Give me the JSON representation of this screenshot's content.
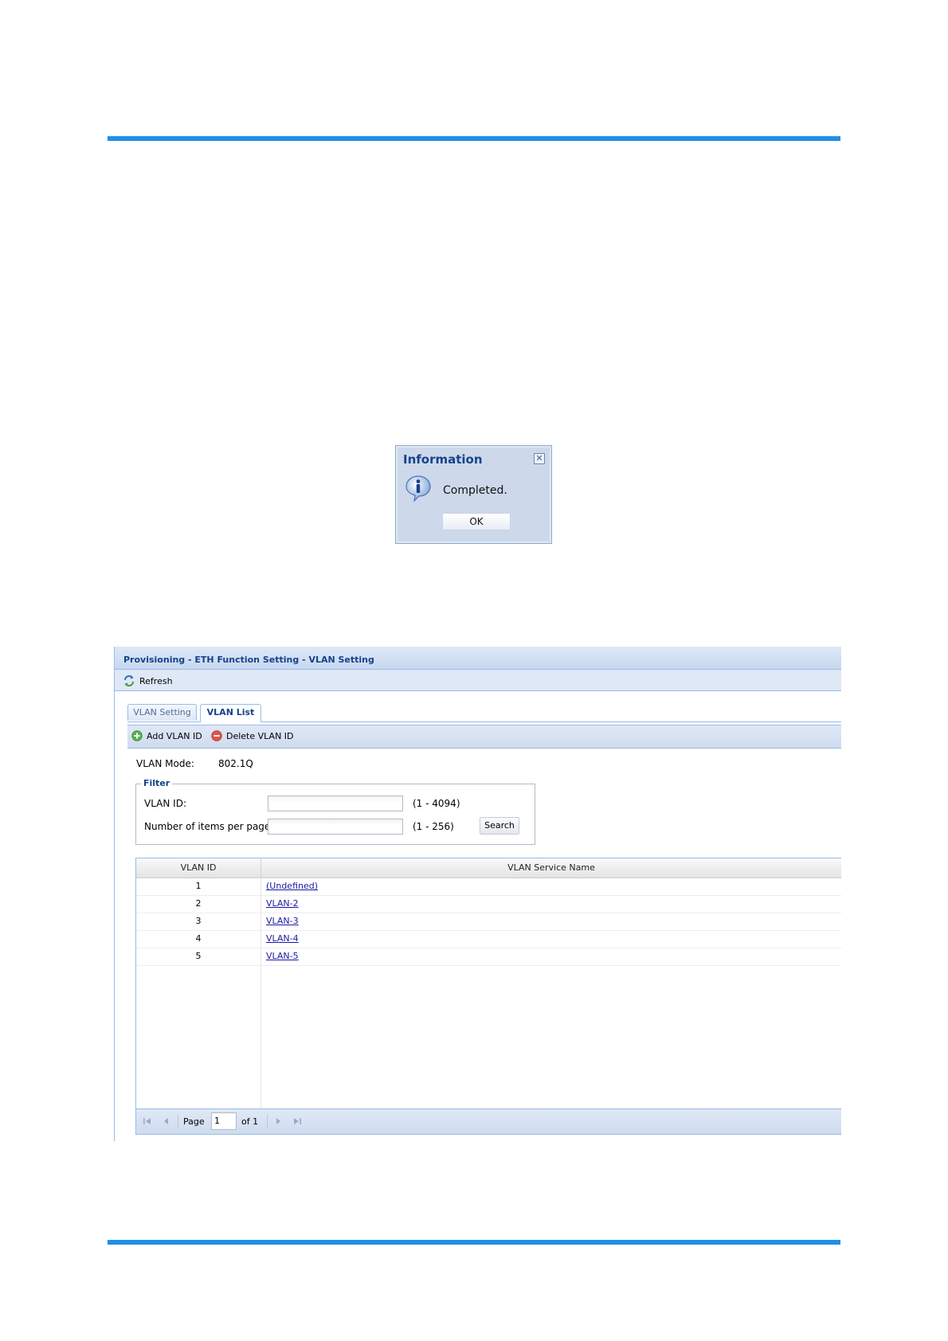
{
  "dialog": {
    "title": "Information",
    "close_glyph": "✕",
    "message": "Completed.",
    "ok_label": "OK",
    "icon": "info-icon"
  },
  "panel": {
    "breadcrumb": "Provisioning - ETH Function Setting - VLAN Setting",
    "refresh_label": "Refresh",
    "tabs": [
      {
        "label": "VLAN Setting",
        "active": false
      },
      {
        "label": "VLAN List",
        "active": true
      }
    ],
    "add_label": "Add VLAN ID",
    "delete_label": "Delete VLAN ID",
    "mode_label": "VLAN Mode:",
    "mode_value": "802.1Q",
    "filter": {
      "legend": "Filter",
      "vlan_id_label": "VLAN ID:",
      "vlan_id_value": "",
      "vlan_id_range": "(1 - 4094)",
      "items_label": "Number of items per page:",
      "items_value": "",
      "items_range": "(1 - 256)",
      "search_label": "Search"
    },
    "grid": {
      "columns": [
        "VLAN ID",
        "VLAN Service Name"
      ],
      "rows": [
        {
          "id": "1",
          "name": "(Undefined)"
        },
        {
          "id": "2",
          "name": "VLAN-2"
        },
        {
          "id": "3",
          "name": "VLAN-3"
        },
        {
          "id": "4",
          "name": "VLAN-4"
        },
        {
          "id": "5",
          "name": "VLAN-5"
        }
      ]
    },
    "pager": {
      "page_label": "Page",
      "page_value": "1",
      "of_label": "of 1"
    }
  },
  "colors": {
    "accent_rule": "#1e90e8",
    "header_text": "#15428b",
    "link": "#1a1aa6"
  }
}
